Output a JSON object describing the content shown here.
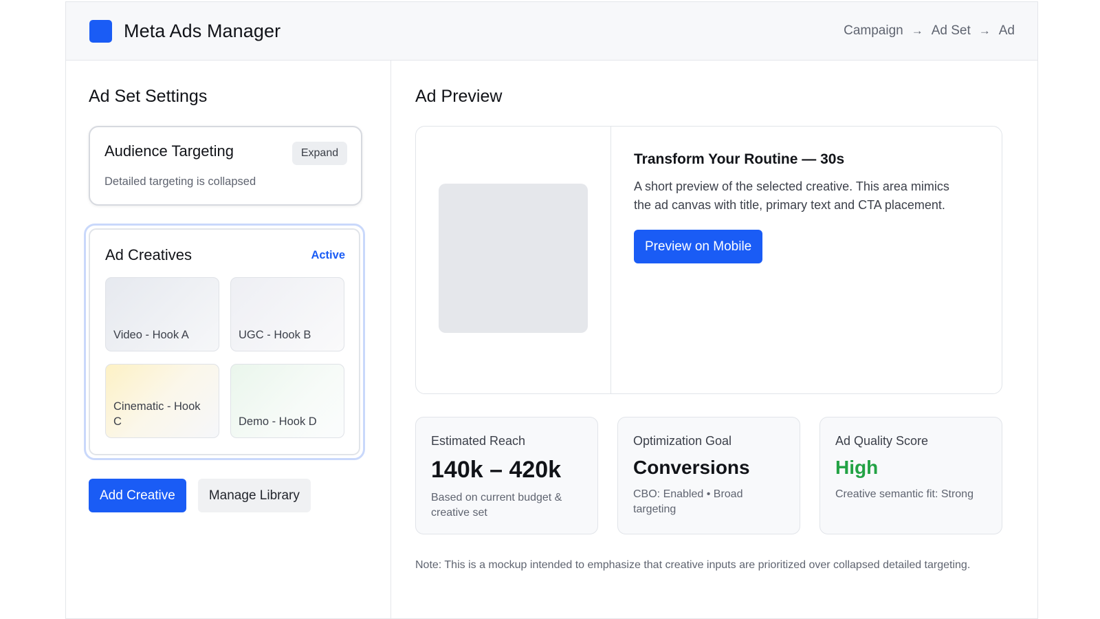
{
  "header": {
    "app_title": "Meta Ads Manager",
    "breadcrumb": [
      "Campaign",
      "Ad Set",
      "Ad"
    ],
    "breadcrumb_separator": "→",
    "accent_color": "#1a5cf5"
  },
  "left": {
    "title": "Ad Set Settings",
    "audience": {
      "title": "Audience Targeting",
      "expand_label": "Expand",
      "status_text": "Detailed targeting is collapsed"
    },
    "creatives": {
      "title": "Ad Creatives",
      "status": "Active",
      "items": [
        {
          "label": "Video - Hook A"
        },
        {
          "label": "UGC - Hook B"
        },
        {
          "label": "Cinematic - Hook C"
        },
        {
          "label": "Demo - Hook D"
        }
      ]
    },
    "actions": {
      "add_label": "Add Creative",
      "manage_label": "Manage Library"
    }
  },
  "right": {
    "title": "Ad Preview",
    "preview": {
      "headline": "Transform Your Routine — 30s",
      "body": "A short preview of the selected creative. This area mimics the ad canvas with title, primary text and CTA placement.",
      "cta_label": "Preview on Mobile"
    },
    "metrics": [
      {
        "label": "Estimated Reach",
        "value": "140k – 420k",
        "sub": "Based on current budget & creative set"
      },
      {
        "label": "Optimization Goal",
        "value": "Conversions",
        "sub": "CBO: Enabled • Broad targeting"
      },
      {
        "label": "Ad Quality Score",
        "value": "High",
        "sub": "Creative semantic fit: Strong",
        "value_color": "#22a244"
      }
    ],
    "note": "Note: This is a mockup intended to emphasize that creative inputs are prioritized over collapsed detailed targeting."
  }
}
